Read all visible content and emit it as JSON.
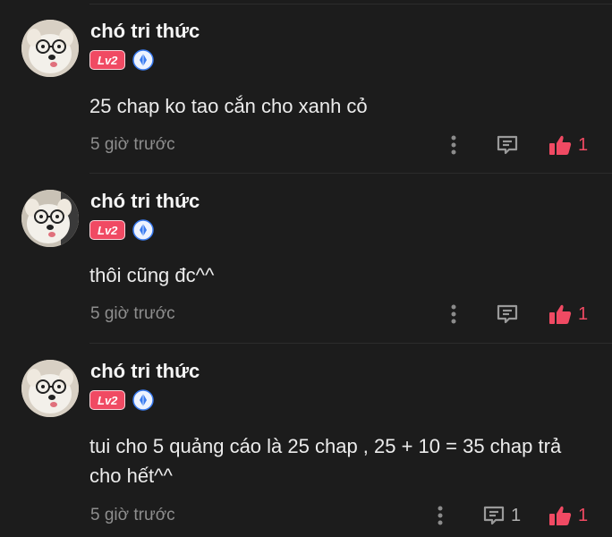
{
  "comments": [
    {
      "username": "chó tri thức",
      "level": "Lv2",
      "text": "25 chap ko tao cắn cho xanh cỏ",
      "time": "5 giờ trước",
      "reply_count": "",
      "like_count": "1"
    },
    {
      "username": "chó tri thức",
      "level": "Lv2",
      "text": "thôi cũng đc^^",
      "time": "5 giờ trước",
      "reply_count": "",
      "like_count": "1"
    },
    {
      "username": "chó tri thức",
      "level": "Lv2",
      "text": "tui cho 5 quảng cáo là 25 chap , 25 + 10 = 35 chap trả cho hết^^",
      "time": "5 giờ trước",
      "reply_count": "1",
      "like_count": "1"
    }
  ],
  "icons": {
    "more": "more-vertical-icon",
    "reply": "comment-icon",
    "like": "thumbs-up-icon",
    "badge": "crystal-badge-icon"
  },
  "colors": {
    "background": "#1c1c1c",
    "accent": "#f04a63",
    "badge_blue": "#3a7bf0",
    "muted_text": "#8e8e8e"
  }
}
